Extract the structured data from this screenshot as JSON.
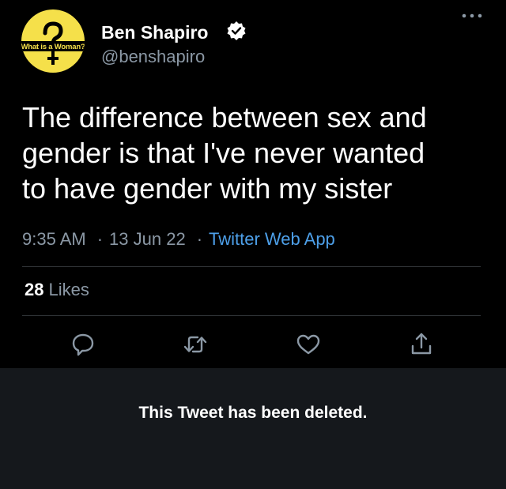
{
  "author": {
    "avatar_text": "What is a Woman?",
    "name": "Ben Shapiro",
    "handle": "@benshapiro",
    "verified": true
  },
  "tweet": {
    "text_lines": [
      "The difference between sex and",
      "gender is that I've never wanted",
      "to have gender with my sister"
    ],
    "time": "9:35 AM",
    "date": "13 Jun 22",
    "source": "Twitter Web App",
    "separator": "·"
  },
  "stats": {
    "likes_count": "28",
    "likes_label": "Likes"
  },
  "actions": [
    "reply-icon",
    "retweet-icon",
    "like-icon",
    "share-icon"
  ],
  "notice": {
    "deleted_text": "This Tweet has been deleted."
  },
  "colors": {
    "background": "#000000",
    "text": "#ffffff",
    "secondary": "#8b98a5",
    "link": "#4d9fe8",
    "avatar_bg": "#f5e04a",
    "notice_bg": "#15181c"
  }
}
